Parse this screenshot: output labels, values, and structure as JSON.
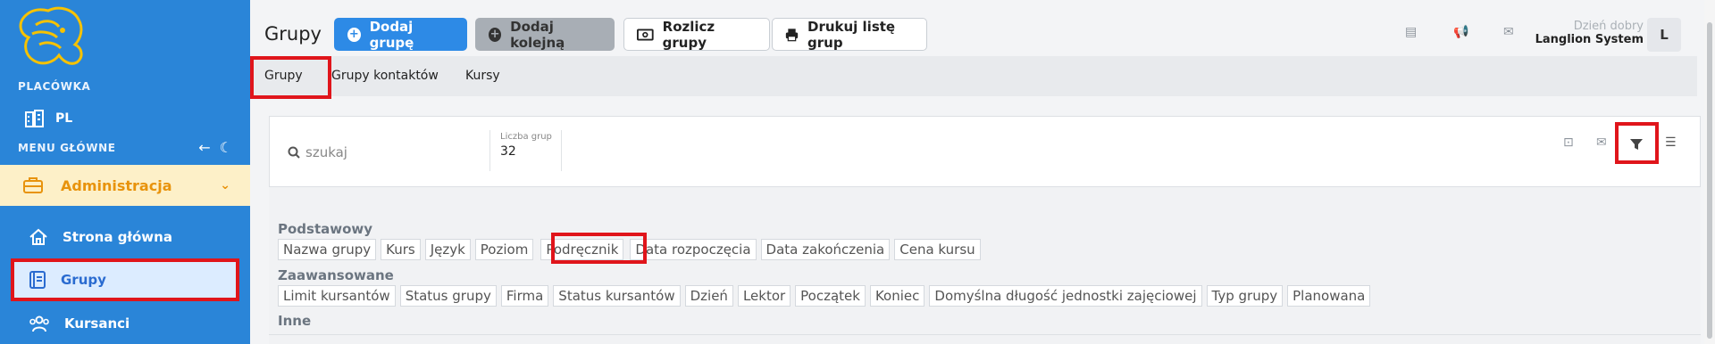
{
  "sidebar": {
    "placowka_label": "PLACÓWKA",
    "placowka_value": "PL",
    "menu_label": "MENU GŁÓWNE",
    "admin_label": "Administracja",
    "items": [
      {
        "label": "Strona główna"
      },
      {
        "label": "Grupy"
      },
      {
        "label": "Kursanci"
      }
    ]
  },
  "header": {
    "title": "Grupy",
    "buttons": {
      "add_group": "Dodaj grupę",
      "add_next": "Dodaj kolejną",
      "settle": "Rozlicz grupy",
      "print": "Drukuj listę grup"
    },
    "greeting": "Dzień dobry",
    "user_name": "Langlion System",
    "avatar_letter": "L"
  },
  "tabs": [
    "Grupy",
    "Grupy kontaktów",
    "Kursy"
  ],
  "search": {
    "placeholder": "szukaj"
  },
  "stats": {
    "label": "Liczba grup",
    "value": "32"
  },
  "columns": {
    "basic_title": "Podstawowy",
    "basic": [
      "Nazwa grupy",
      "Kurs",
      "Język",
      "Poziom",
      "Podręcznik",
      "Data rozpoczęcia",
      "Data zakończenia",
      "Cena kursu"
    ],
    "advanced_title": "Zaawansowane",
    "advanced": [
      "Limit kursantów",
      "Status grupy",
      "Firma",
      "Status kursantów",
      "Dzień",
      "Lektor",
      "Początek",
      "Koniec",
      "Domyślna długość jednostki zajęciowej",
      "Typ grupy",
      "Planowana"
    ],
    "other_title": "Inne"
  },
  "colors": {
    "sidebar_bg": "#2a85d8",
    "primary": "#2d8ae6",
    "highlight": "#e0151b",
    "admin_bg": "#fdf0c8",
    "admin_text": "#e8930c"
  }
}
